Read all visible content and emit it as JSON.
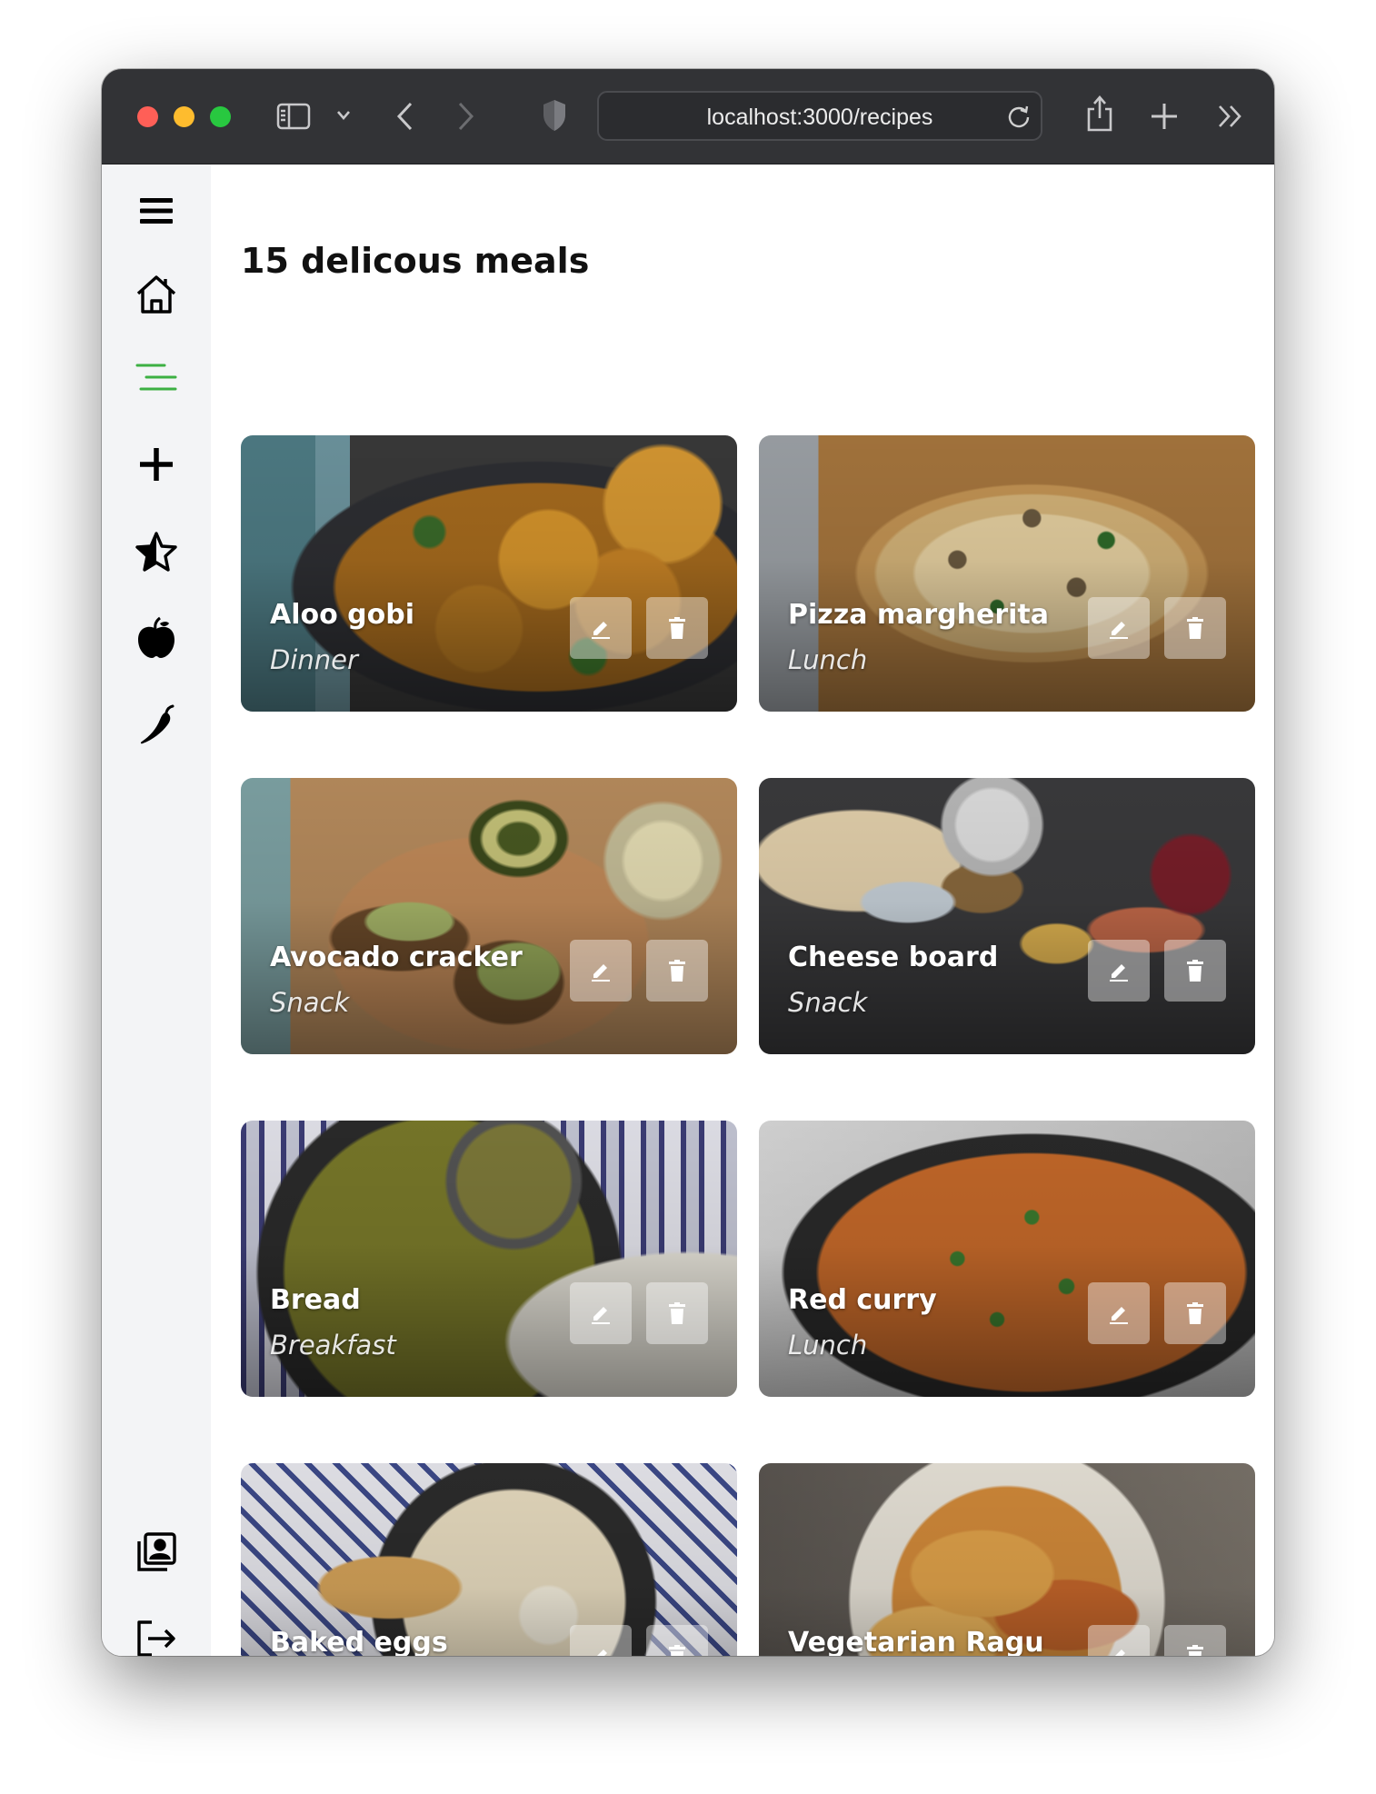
{
  "browser": {
    "url": "localhost:3000/recipes"
  },
  "sidebar": {
    "items": [
      {
        "name": "menu",
        "icon": "hamburger-menu-icon"
      },
      {
        "name": "home",
        "icon": "home-icon"
      },
      {
        "name": "recipes",
        "icon": "list-icon",
        "active": true,
        "color": "#3cb043"
      },
      {
        "name": "add",
        "icon": "plus-icon"
      },
      {
        "name": "favorites",
        "icon": "star-icon"
      },
      {
        "name": "fruit",
        "icon": "apple-icon"
      },
      {
        "name": "spicy",
        "icon": "chili-icon"
      },
      {
        "name": "profile",
        "icon": "contact-book-icon"
      },
      {
        "name": "logout",
        "icon": "logout-icon"
      }
    ]
  },
  "main": {
    "title": "15 delicous meals",
    "recipes": [
      {
        "name": "Aloo gobi",
        "meal": "Dinner"
      },
      {
        "name": "Pizza margherita",
        "meal": "Lunch"
      },
      {
        "name": "Avocado cracker",
        "meal": "Snack"
      },
      {
        "name": "Cheese board",
        "meal": "Snack"
      },
      {
        "name": "Bread",
        "meal": "Breakfast"
      },
      {
        "name": "Red curry",
        "meal": "Lunch"
      },
      {
        "name": "Baked eggs",
        "meal": ""
      },
      {
        "name": "Vegetarian Ragu",
        "meal": ""
      }
    ]
  }
}
